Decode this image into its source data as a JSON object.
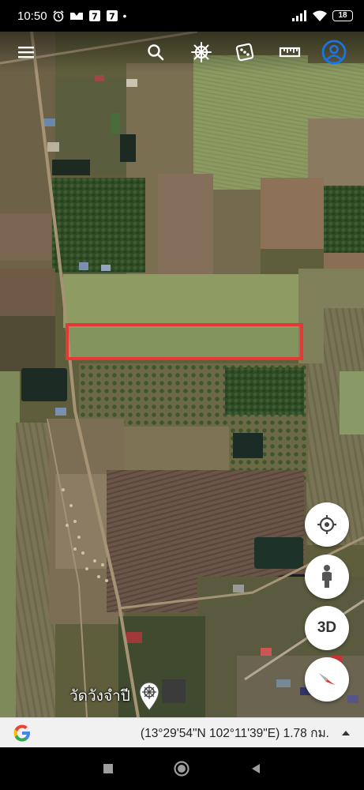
{
  "status_bar": {
    "time": "10:50",
    "battery": "18",
    "icons": [
      "alarm-icon",
      "notification-icon",
      "notification-icon",
      "notification-icon",
      "signal-icon",
      "wifi-icon",
      "battery-icon"
    ]
  },
  "toolbar": {
    "icons": [
      "menu-icon",
      "search-icon",
      "voyager-wheel-icon",
      "dice-icon",
      "ruler-icon",
      "account-icon"
    ]
  },
  "map": {
    "place_label": "วัดวังจำปี",
    "highlight_color": "#e53935"
  },
  "fab": {
    "three_d_label": "3D",
    "icons": [
      "my-location-icon",
      "pegman-icon",
      "compass-icon"
    ]
  },
  "info_bar": {
    "coordinates": "(13°29'54\"N 102°11'39\"E) 1.78 กม.",
    "icons": [
      "google-g-icon",
      "expand-up-icon"
    ]
  },
  "nav_bar": {
    "icons": [
      "recents-icon",
      "home-icon",
      "back-icon"
    ]
  },
  "colors": {
    "accent_blue": "#1a73e8",
    "compass_red": "#e53935"
  }
}
